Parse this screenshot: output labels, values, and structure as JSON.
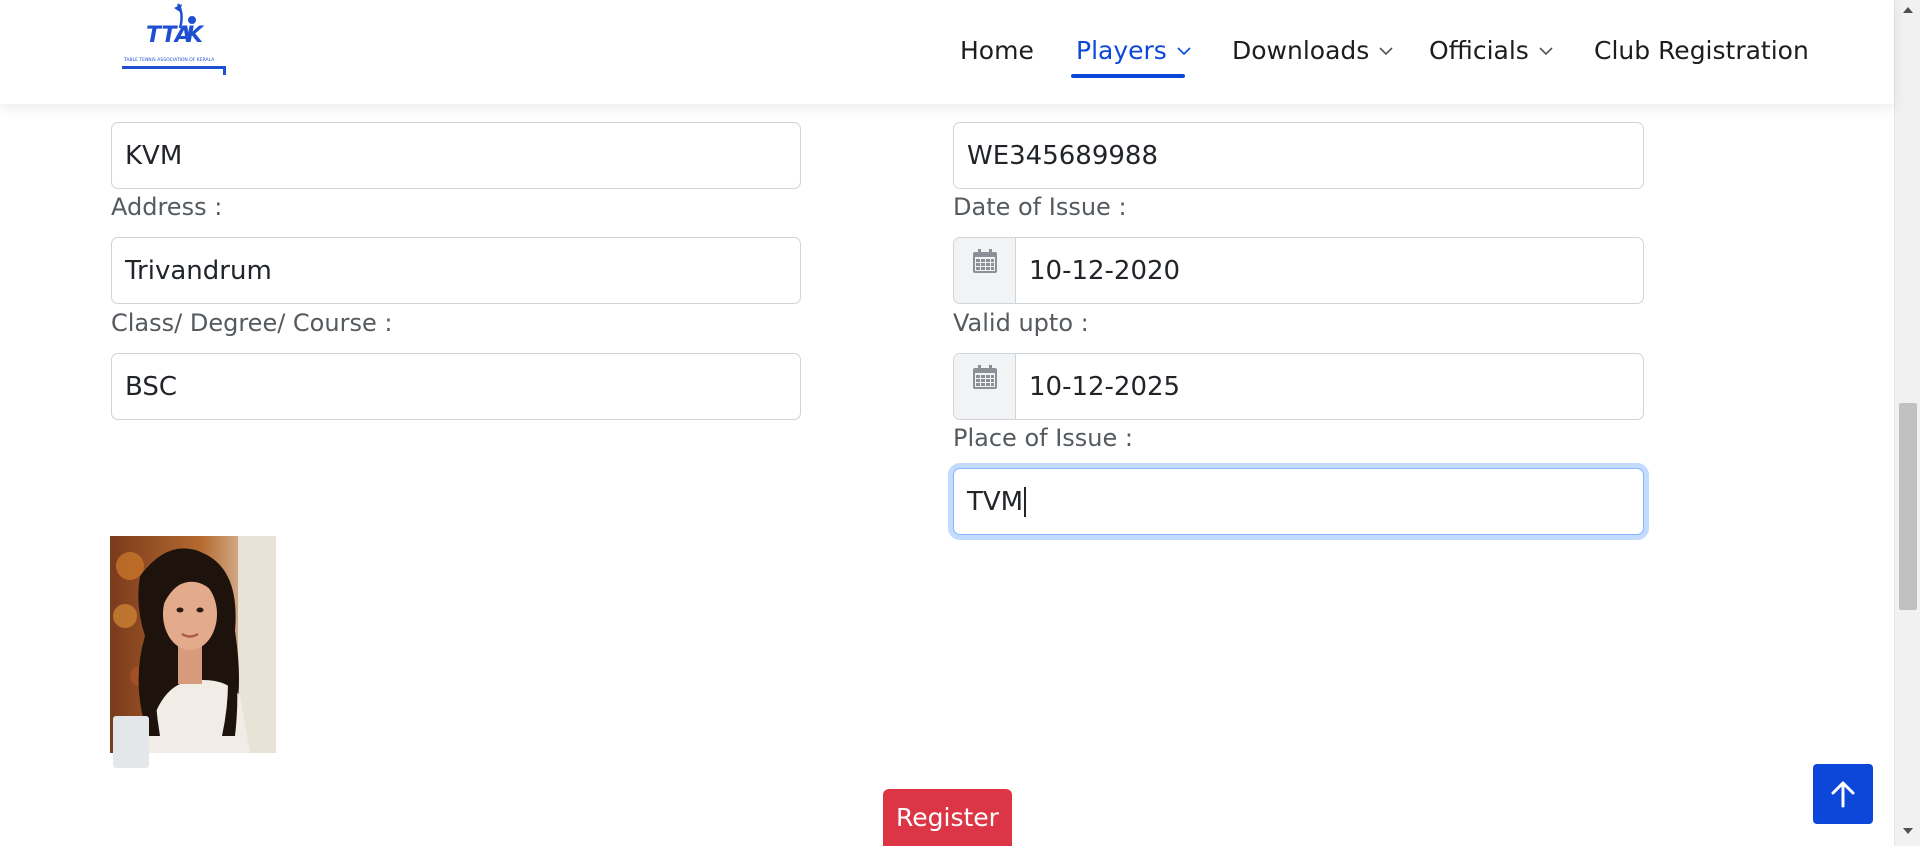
{
  "header": {
    "logo_alt": "TTAK - Table Tennis Association of Kerala",
    "logo_text": "TTAK",
    "logo_subtitle": "TABLE TENNIS ASSOCIATION OF KERALA",
    "nav": {
      "home": "Home",
      "players": "Players",
      "downloads": "Downloads",
      "officials": "Officials",
      "club_registration": "Club Registration"
    },
    "active_nav": "Players",
    "accent_color": "#0d47d9"
  },
  "form": {
    "left": {
      "institution_value": "KVM",
      "address_label": "Address :",
      "address_value": "Trivandrum",
      "class_label": "Class/ Degree/ Course :",
      "class_value": "BSC"
    },
    "right": {
      "id_number_value": "WE345689988",
      "date_of_issue_label": "Date of Issue :",
      "date_of_issue_value": "10-12-2020",
      "valid_upto_label": "Valid upto :",
      "valid_upto_value": "10-12-2025",
      "place_of_issue_label": "Place of Issue :",
      "place_of_issue_value": "TVM"
    }
  },
  "actions": {
    "register_label": "Register",
    "register_color": "#dc3545"
  },
  "icons": {
    "calendar": "calendar-icon",
    "back_to_top": "arrow-up-icon",
    "chevron": "chevron-down-icon"
  }
}
